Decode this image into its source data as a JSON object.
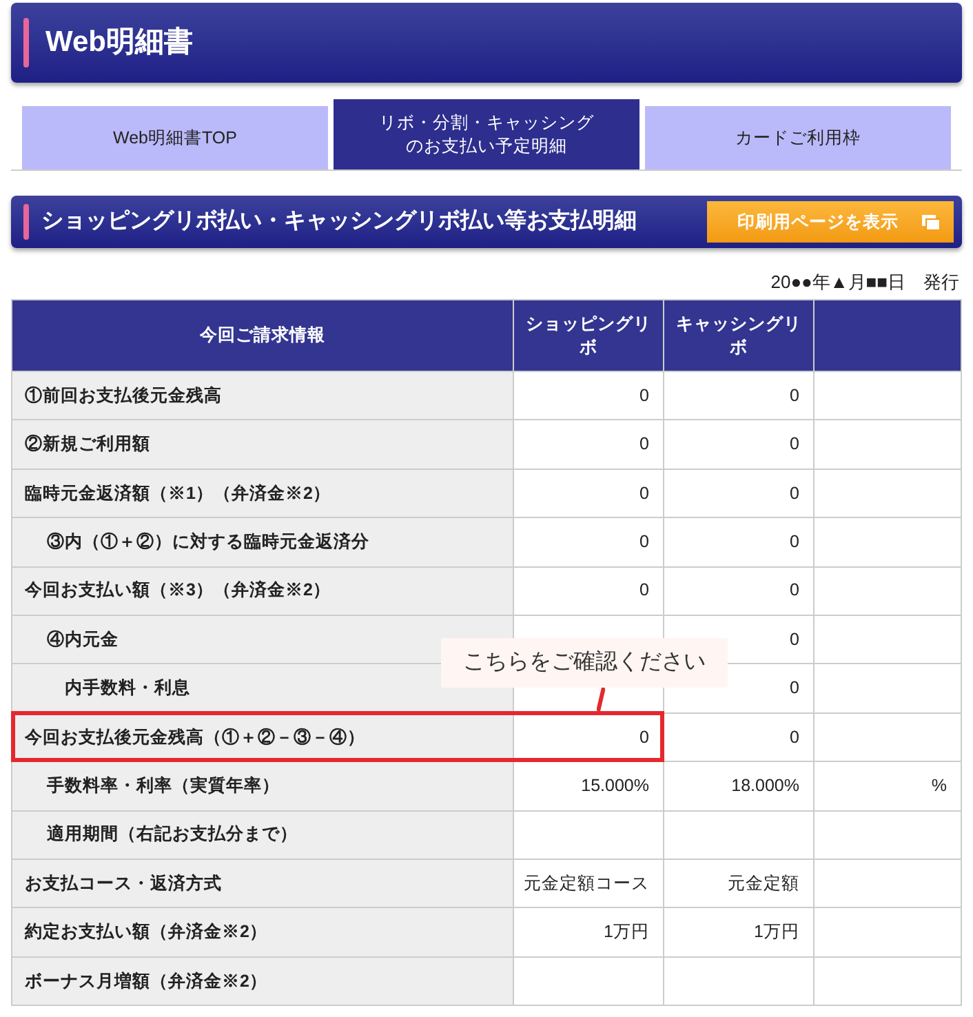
{
  "header": {
    "title": "Web明細書"
  },
  "tabs": [
    {
      "label": "Web明細書TOP",
      "selected": false
    },
    {
      "label": "リボ・分割・キャッシングのお支払い予定明細",
      "selected": true
    },
    {
      "label": "カードご利用枠",
      "selected": false
    }
  ],
  "section": {
    "title": "ショッピングリボ払い・キャッシングリボ払い等お支払明細",
    "print_button": "印刷用ページを表示"
  },
  "issue_date": "20●●年▲月■■日　発行",
  "table": {
    "columns": [
      "今回ご請求情報",
      "ショッピングリボ",
      "キャッシングリボ"
    ],
    "rows": [
      {
        "label": "①前回お支払後元金残高",
        "shopping": "0",
        "cashing": "0"
      },
      {
        "label": "②新規ご利用額",
        "shopping": "0",
        "cashing": "0"
      },
      {
        "label": "臨時元金返済額（※1）（弁済金※2）",
        "shopping": "0",
        "cashing": "0",
        "children": [
          {
            "label": "③内（①＋②）に対する臨時元金返済分",
            "shopping": "0",
            "cashing": "0"
          }
        ]
      },
      {
        "label": "今回お支払い額（※3）（弁済金※2）",
        "shopping": "0",
        "cashing": "0",
        "children": [
          {
            "label": "④内元金",
            "cashing": "0",
            "children": [
              {
                "label": "内手数料・利息",
                "cashing": "0"
              }
            ]
          }
        ]
      },
      {
        "label": "今回お支払後元金残高（①＋②－③－④）",
        "shopping": "0",
        "cashing": "0",
        "highlighted": true,
        "children": [
          {
            "label": "手数料率・利率（実質年率）",
            "shopping": "15.000%",
            "cashing": "18.000%",
            "column_4": "%"
          },
          {
            "label": "適用期間（右記お支払分まで）"
          }
        ]
      },
      {
        "label": "お支払コース・返済方式",
        "shopping": "元金定額コース",
        "cashing": "元金定額"
      },
      {
        "label": "約定お支払い額（弁済金※2）",
        "shopping": "1万円",
        "cashing": "1万円"
      },
      {
        "label": "ボーナス月増額（弁済金※2）"
      }
    ]
  },
  "callout": {
    "text": "こちらをご確認ください"
  }
}
